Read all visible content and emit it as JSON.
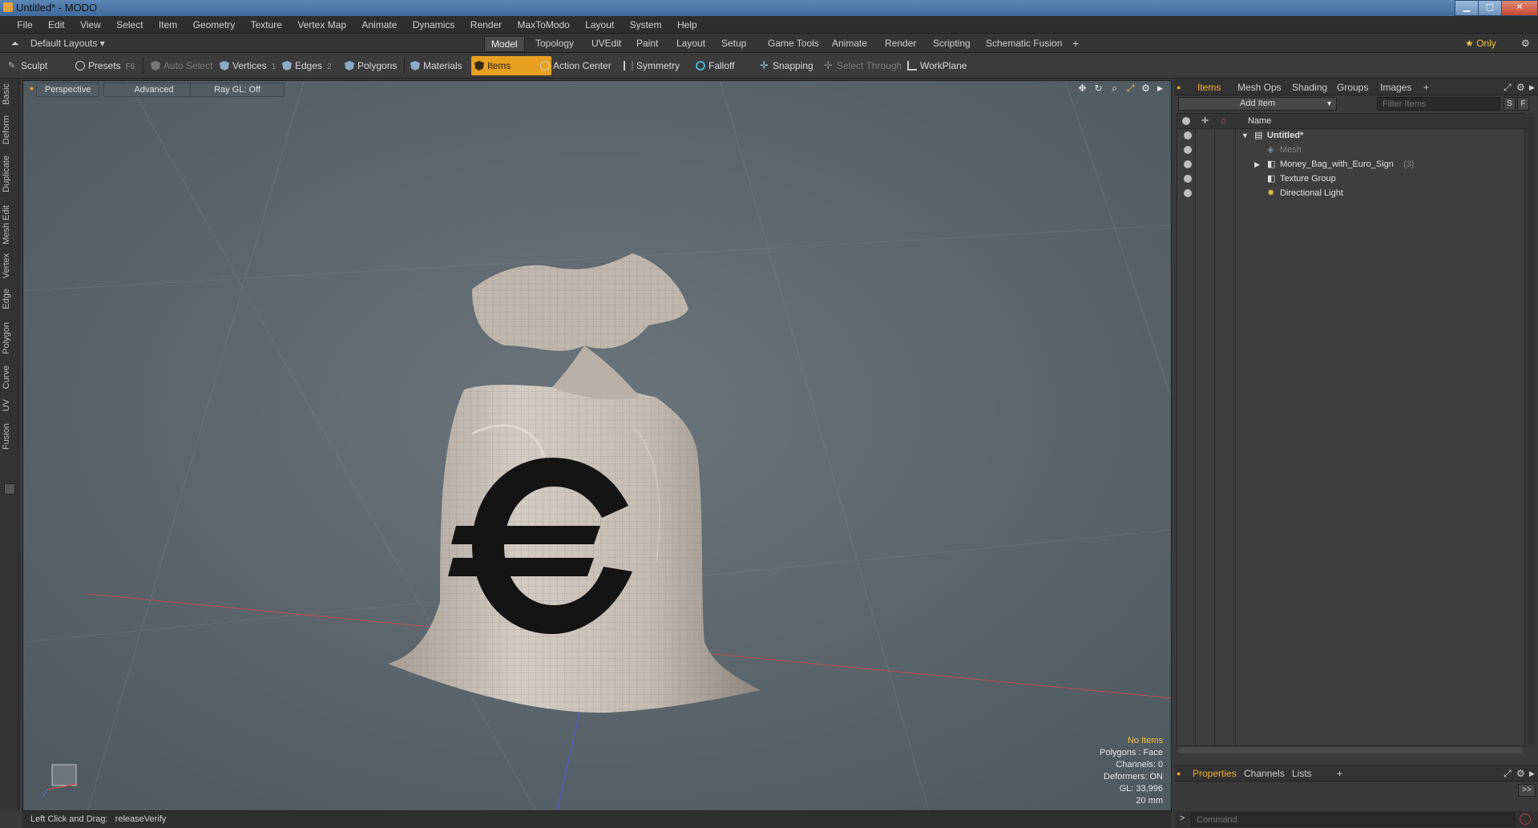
{
  "window": {
    "title": "Untitled* - MODO",
    "min_label": "▁",
    "max_label": "▢",
    "close_label": "✕"
  },
  "menubar": [
    "File",
    "Edit",
    "View",
    "Select",
    "Item",
    "Geometry",
    "Texture",
    "Vertex Map",
    "Animate",
    "Dynamics",
    "Render",
    "MaxToModo",
    "Layout",
    "System",
    "Help"
  ],
  "layoutbar": {
    "layouts_label": "Default Layouts ▾",
    "tabs": [
      "Model",
      "Topology",
      "UVEdit",
      "Paint",
      "Layout",
      "Setup",
      "Game Tools",
      "Animate",
      "Render",
      "Scripting",
      "Schematic Fusion"
    ],
    "active_tab": "Model",
    "add_label": "+",
    "only_label": "★  Only"
  },
  "toolbar": {
    "sculpt": "Sculpt",
    "presets": "Presets",
    "presets_key": "F6",
    "auto_select": "Auto Select",
    "vertices": "Vertices",
    "vertices_key": "1",
    "edges": "Edges",
    "edges_key": "2",
    "polygons": "Polygons",
    "materials": "Materials",
    "items": "Items",
    "action_center": "Action Center",
    "symmetry": "Symmetry",
    "falloff": "Falloff",
    "snapping": "Snapping",
    "select_through": "Select Through",
    "workplane": "WorkPlane"
  },
  "left_tabs": [
    "Basic",
    "Deform",
    "Duplicate",
    "Mesh Edit",
    "Vertex",
    "Edge",
    "Polygon",
    "Curve",
    "UV",
    "Fusion"
  ],
  "viewport": {
    "view_mode": "Perspective",
    "advanced": "Advanced",
    "raygl": "Ray GL: Off",
    "stats": {
      "selection": "No Items",
      "polygons": "Polygons : Face",
      "channels": "Channels: 0",
      "deformers": "Deformers: ON",
      "gl": "GL: 33,996",
      "scale": "20 mm"
    },
    "colors": {
      "background": "#5c666d",
      "bag": "#c9c2ba",
      "euro": "#141414"
    }
  },
  "statusline": {
    "hint_label": "Left Click and Drag:",
    "hint_value": "releaseVerify"
  },
  "items_panel": {
    "tabs": [
      "Items",
      "Mesh Ops",
      "Shading",
      "Groups",
      "Images"
    ],
    "active_tab": "Items",
    "add_item": "Add Item",
    "filter_placeholder": "Filter Items",
    "filter_s": "S",
    "filter_f": "F",
    "column_name": "Name",
    "tree": [
      {
        "label": "Untitled*",
        "depth": 0,
        "expanded": true
      },
      {
        "label": "Mesh",
        "depth": 1,
        "dim": true
      },
      {
        "label": "Money_Bag_with_Euro_Sign",
        "count": "(3)",
        "depth": 1,
        "collapsed": true
      },
      {
        "label": "Texture Group",
        "depth": 1
      },
      {
        "label": "Directional Light",
        "depth": 1
      }
    ]
  },
  "properties_panel": {
    "tabs": [
      "Properties",
      "Channels",
      "Lists"
    ],
    "active_tab": "Properties",
    "expand_label": ">>"
  },
  "command": {
    "prompt": ">",
    "placeholder": "Command"
  }
}
